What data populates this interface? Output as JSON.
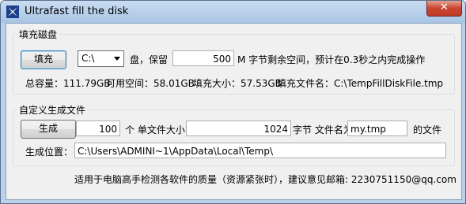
{
  "window": {
    "title": "Ultrafast fill the disk",
    "close_label": "✕",
    "icon": "app-icon"
  },
  "fill_group": {
    "title": "填充磁盘",
    "fill_button": "填充",
    "drive_selected": "C:\\",
    "drive_suffix": "盘，保留",
    "reserve_value": "500",
    "reserve_suffix": "M 字节剩余空间，预计在0.3秒之内完成操作",
    "total_label": "总容量：111.79GB",
    "free_label": "可用空间：58.01GB",
    "fill_size_label": "填充大小：57.53GB",
    "fill_file_label": "填充文件名：C:\\TempFillDiskFile.tmp"
  },
  "custom_group": {
    "title": "自定义生成文件",
    "generate_button": "生成",
    "count_value": "100",
    "count_suffix": "个 单文件大小",
    "size_value": "1024",
    "size_suffix": "字节 文件名为000.",
    "ext_value": "my.tmp",
    "ext_suffix": "的文件",
    "location_label": "生成位置：",
    "location_value": "C:\\Users\\ADMINI~1\\AppData\\Local\\Temp\\"
  },
  "footer": {
    "text": "适用于电脑高手检测各软件的质量（资源紧张时），建议意见邮箱: 2230751150@qq.com"
  }
}
